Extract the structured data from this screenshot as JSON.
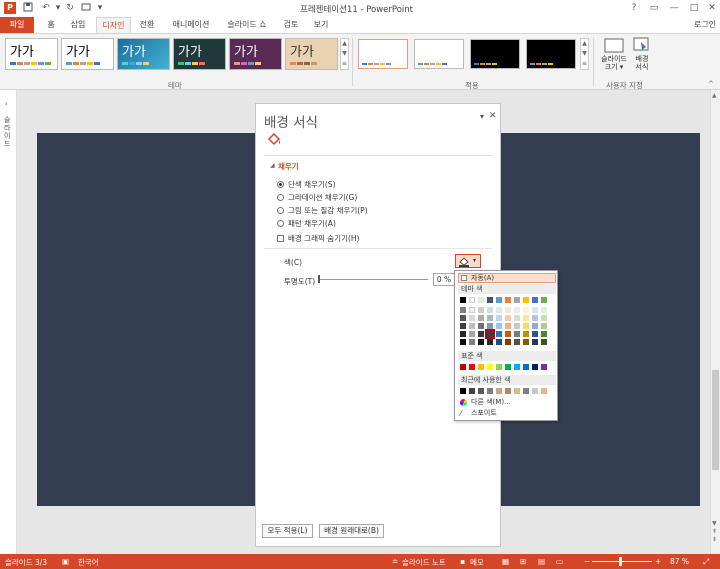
{
  "window": {
    "title": "프레젠테이션11 - PowerPoint",
    "app_icon": "P",
    "controls": [
      "?",
      "▭",
      "—",
      "□",
      "✕"
    ],
    "user": "로그인"
  },
  "qat": [
    "save-icon",
    "undo-icon",
    "redo-icon",
    "repeat-icon",
    "customize-icon"
  ],
  "tabs": [
    "파일",
    "홈",
    "삽입",
    "디자인",
    "전환",
    "애니메이션",
    "슬라이드 쇼",
    "검토",
    "보기"
  ],
  "active_tab": "디자인",
  "ribbon": {
    "themes_group": "테마",
    "variants_group": "적용",
    "customize_group": "사용자 지정",
    "theme_samples": [
      "가가",
      "가가",
      "가가",
      "가가",
      "가가",
      "가가"
    ],
    "slide_size": "슬라이드\n크기 ▾",
    "format_background": "배경\n서식"
  },
  "panel": {
    "title": "배경 서식",
    "close": "✕",
    "dropdown": "▾",
    "section": "채우기",
    "options": [
      {
        "label": "단색 채우기(S)",
        "selected": true
      },
      {
        "label": "그라데이션 채우기(G)",
        "selected": false
      },
      {
        "label": "그림 또는 질감 채우기(P)",
        "selected": false
      },
      {
        "label": "패턴 채우기(A)",
        "selected": false
      }
    ],
    "hide_graphics": "배경 그래픽 숨기기(H)",
    "color_label": "색(C)",
    "transparency_label": "투명도(T)",
    "transparency_value": "0 %",
    "apply_all": "모두 적용(L)",
    "reset": "배경 원래대로(B)"
  },
  "palette": {
    "auto": "자동(A)",
    "theme_colors_label": "테마 색",
    "standard_label": "표준 색",
    "recent_label": "최근에 사용한 색",
    "more_colors": "다른 색(M)...",
    "eyedropper": "스포이트",
    "theme_top": [
      "#000000",
      "#ffffff",
      "#e7e6e6",
      "#44546a",
      "#5b9bd5",
      "#ed7d31",
      "#a5a5a5",
      "#ffc000",
      "#4472c4",
      "#70ad47"
    ],
    "theme_tints": [
      [
        "#7f7f7f",
        "#f2f2f2",
        "#d0cece",
        "#d6dce4",
        "#deebf6",
        "#fbe5d5",
        "#ededed",
        "#fff2cc",
        "#dae3f3",
        "#e2efd9"
      ],
      [
        "#595959",
        "#d8d8d8",
        "#aeabab",
        "#adb9ca",
        "#bdd7ee",
        "#f7cbac",
        "#dbdbdb",
        "#fee599",
        "#b4c6e7",
        "#c5e0b3"
      ],
      [
        "#3f3f3f",
        "#bfbfbf",
        "#757070",
        "#8496b0",
        "#9dc3e6",
        "#f4b183",
        "#c9c9c9",
        "#ffd966",
        "#8eaadb",
        "#a8d08d"
      ],
      [
        "#262626",
        "#a5a5a5",
        "#3a3838",
        "#323f4f",
        "#2e75b5",
        "#c55a11",
        "#7b7b7b",
        "#bf9000",
        "#2f5496",
        "#538135"
      ],
      [
        "#0c0c0c",
        "#7f7f7f",
        "#171616",
        "#222a35",
        "#1e4e79",
        "#843c0b",
        "#525252",
        "#7f6000",
        "#1f3864",
        "#375623"
      ]
    ],
    "standard": [
      "#c00000",
      "#ff0000",
      "#ffc000",
      "#ffff00",
      "#92d050",
      "#00b050",
      "#00b0f0",
      "#0070c0",
      "#002060",
      "#7030a0"
    ],
    "recent": [
      "#000000",
      "#404040",
      "#595959",
      "#808080",
      "#c4a484",
      "#b08968",
      "#d6b88f",
      "#808080",
      "#c9c9c9",
      "#f4b183"
    ],
    "selected_swatch": "#323f4f"
  },
  "leftpane_text": "슬라이드",
  "status": {
    "slide": "슬라이드 3/3",
    "lang": "한국어",
    "notes": "슬라이드 노트",
    "comments": "메모",
    "zoom": "87 %"
  },
  "colors": {
    "accent": "#d24726",
    "slide_bg": "#323e4f"
  }
}
